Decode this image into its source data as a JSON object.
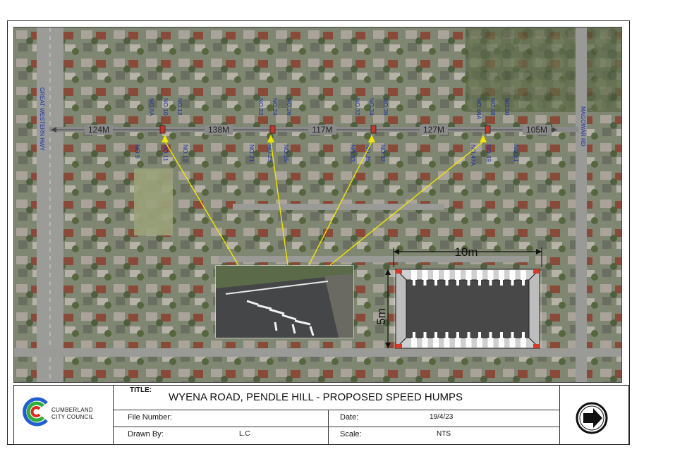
{
  "map": {
    "road_left": "GREAT WESTERN HWY",
    "road_right": "MAGOWAR RD",
    "house_numbers_north": [
      "NO.8A",
      "NO.10",
      "NO.12",
      "NO.22",
      "NO.24",
      "NO.26",
      "NO.32",
      "NO.34",
      "NO.36",
      "NO.46A",
      "NO.48",
      "NO.50"
    ],
    "house_numbers_south": [
      "NO.9",
      "NO.11",
      "NO.13",
      "NO.21",
      "NO.23",
      "NO.25",
      "NO.33",
      "NO.35",
      "NO.37",
      "NO.47A",
      "NO.49",
      "NO.51"
    ],
    "distances": [
      "124M",
      "138M",
      "117M",
      "127M",
      "105M"
    ],
    "hump_count": 4
  },
  "detail": {
    "length_label": "10m",
    "width_label": "5m"
  },
  "title_block": {
    "logo_line1": "CUMBERLAND",
    "logo_line2": "CITY COUNCIL",
    "title_label": "TITLE:",
    "title": "WYENA ROAD, PENDLE HILL - PROPOSED SPEED HUMPS",
    "file_number_label": "File Number:",
    "file_number": "",
    "date_label": "Date:",
    "date": "19/4/23",
    "drawn_by_label": "Drawn By:",
    "drawn_by": "L.C",
    "scale_label": "Scale:",
    "scale": "NTS"
  },
  "colors": {
    "hump_marker": "#c0392b",
    "arrow": "#f3e600",
    "road": "#8a8a8a",
    "logo_blue": "#1f5fd1",
    "logo_green": "#2eae3a",
    "logo_red": "#e0281f"
  },
  "north_arrow_icon": "north-arrow-icon"
}
